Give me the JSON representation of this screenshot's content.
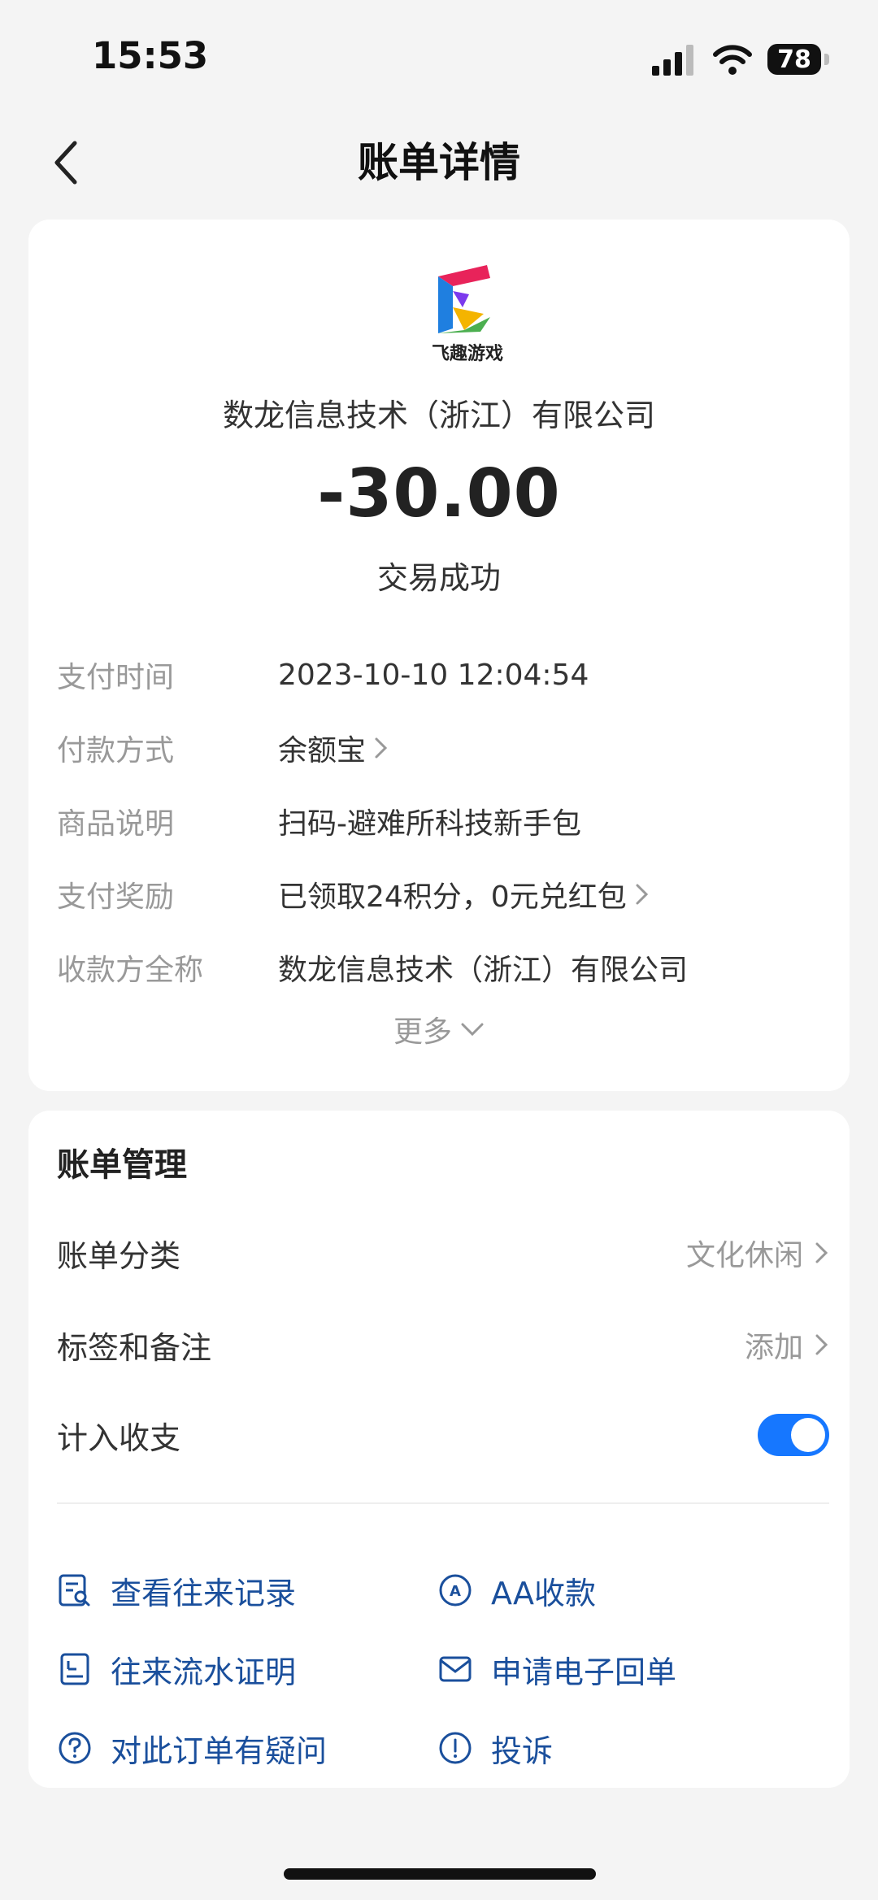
{
  "status_bar": {
    "time": "15:53",
    "battery": "78"
  },
  "nav": {
    "title": "账单详情"
  },
  "header": {
    "logo_text": "飞趣游戏",
    "merchant": "数龙信息技术（浙江）有限公司",
    "amount": "-30.00",
    "status": "交易成功"
  },
  "details": [
    {
      "label": "支付时间",
      "value": "2023-10-10 12:04:54",
      "link": false
    },
    {
      "label": "付款方式",
      "value": "余额宝",
      "link": true
    },
    {
      "label": "商品说明",
      "value": "扫码-避难所科技新手包",
      "link": false
    },
    {
      "label": "支付奖励",
      "value": "已领取24积分，0元兑红包",
      "link": true
    },
    {
      "label": "收款方全称",
      "value": "数龙信息技术（浙江）有限公司",
      "link": false
    }
  ],
  "more_label": "更多",
  "management": {
    "title": "账单管理",
    "category_label": "账单分类",
    "category_value": "文化休闲",
    "tags_label": "标签和备注",
    "tags_value": "添加",
    "include_label": "计入收支",
    "include_enabled": true
  },
  "actions": {
    "view_records": "查看往来记录",
    "aa_collect": "AA收款",
    "statement_proof": "往来流水证明",
    "e_receipt": "申请电子回单",
    "order_question": "对此订单有疑问",
    "complaint": "投诉"
  },
  "colors": {
    "accent": "#1677ff",
    "link": "#1a4f9c",
    "background": "#f4f4f4"
  }
}
